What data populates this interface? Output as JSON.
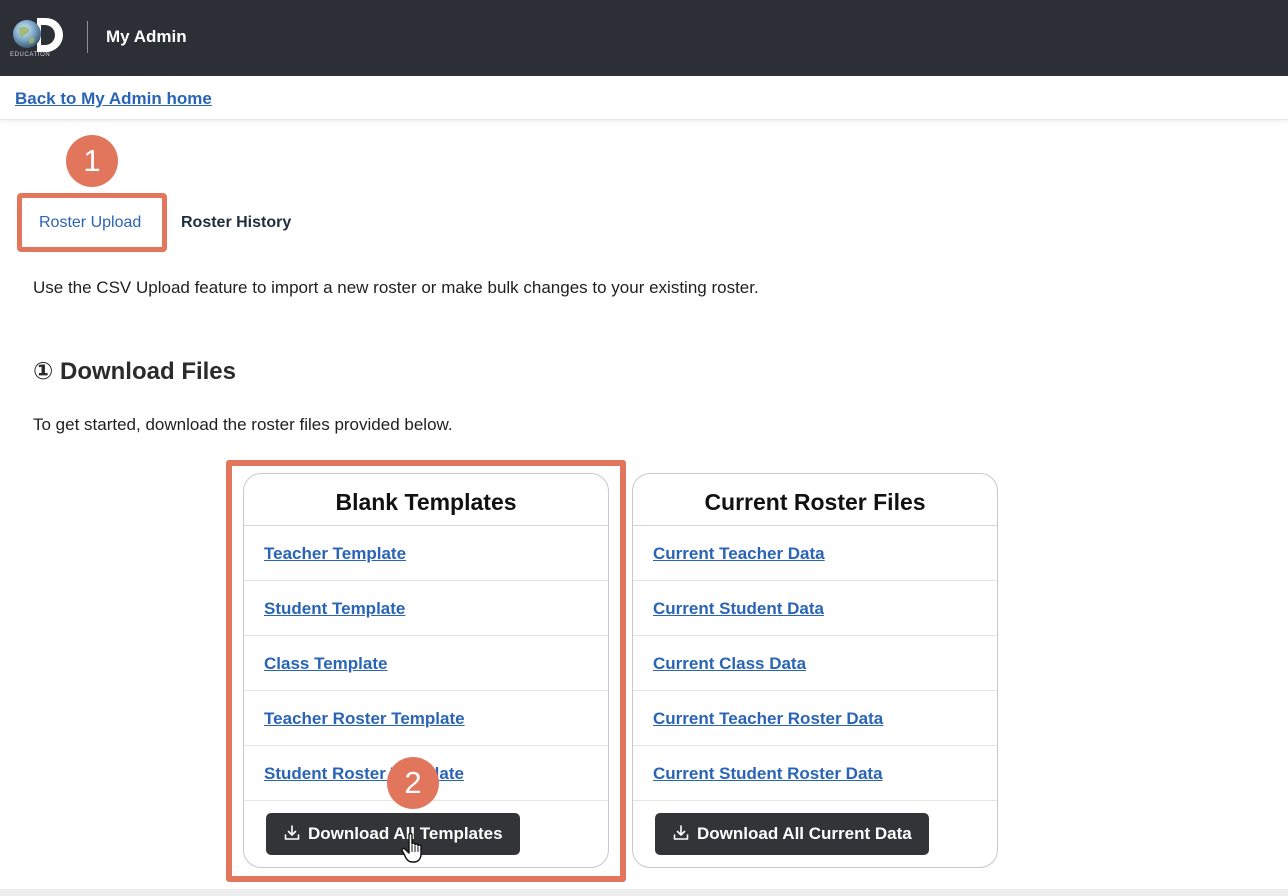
{
  "header": {
    "logo_text": "EDUCATION",
    "app_title": "My Admin"
  },
  "breadcrumb": {
    "back_link": "Back to My Admin home"
  },
  "callouts": [
    "1",
    "2"
  ],
  "tabs": [
    {
      "label": "Roster Upload",
      "active": true
    },
    {
      "label": "Roster History",
      "active": false
    }
  ],
  "intro_text": "Use the CSV Upload feature to import a new roster or make bulk changes to your existing roster.",
  "section": {
    "title": "① Download Files",
    "subtitle": "To get started, download the roster files provided below."
  },
  "cards": [
    {
      "title": "Blank Templates",
      "links": [
        "Teacher Template",
        "Student Template",
        "Class Template",
        "Teacher Roster Template",
        "Student Roster Template"
      ],
      "button": "Download All Templates"
    },
    {
      "title": "Current Roster Files",
      "links": [
        "Current Teacher Data",
        "Current Student Data",
        "Current Class Data",
        "Current Teacher Roster Data",
        "Current Student Roster Data"
      ],
      "button": "Download All Current Data"
    }
  ],
  "colors": {
    "header_bg": "#2d2f36",
    "link": "#2a64b6",
    "highlight": "#e1765d",
    "button_bg": "#333438"
  }
}
